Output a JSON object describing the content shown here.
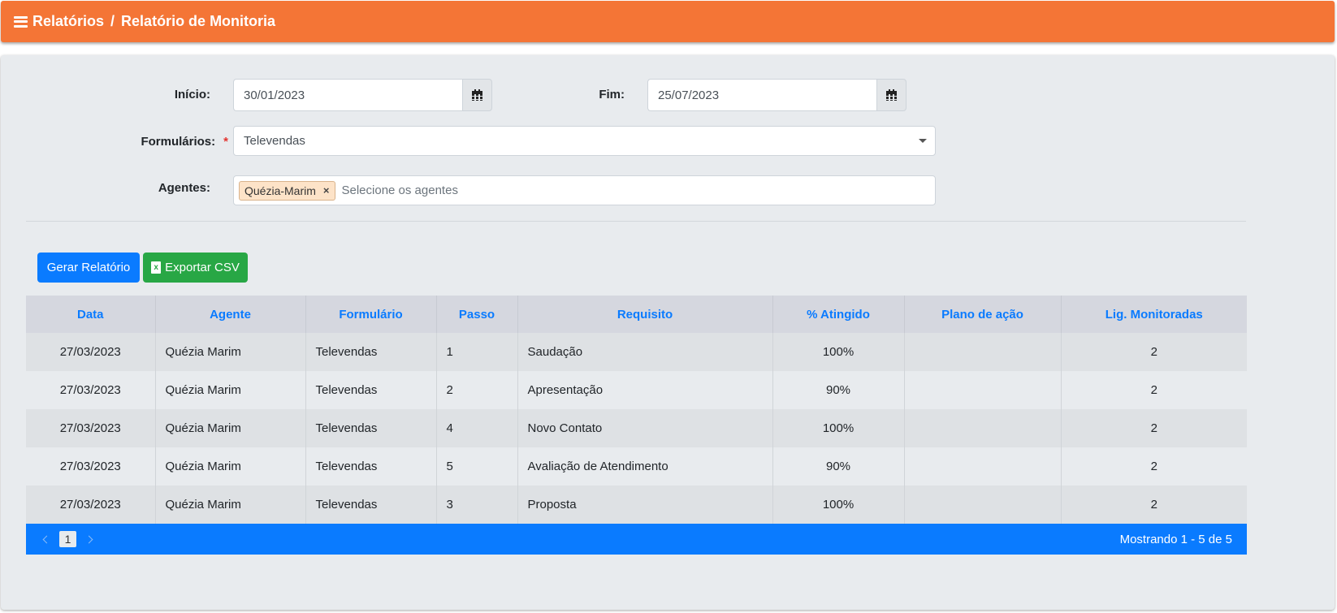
{
  "header": {
    "breadcrumb_root": "Relatórios",
    "separator": "/",
    "breadcrumb_current": "Relatório de Monitoria",
    "accent_color": "#f47536"
  },
  "filters": {
    "start_label": "Início:",
    "start_value": "30/01/2023",
    "end_label": "Fim:",
    "end_value": "25/07/2023",
    "forms_label": "Formulários:",
    "forms_required_mark": "*",
    "forms_value": "Televendas",
    "agents_label": "Agentes:",
    "agents_selected": [
      "Quézia-Marim"
    ],
    "agents_remove_symbol": "×",
    "agents_placeholder": "Selecione os agentes"
  },
  "actions": {
    "generate_label": "Gerar Relatório",
    "export_label": "Exportar CSV",
    "export_icon_letter": "x"
  },
  "table": {
    "columns": [
      "Data",
      "Agente",
      "Formulário",
      "Passo",
      "Requisito",
      "% Atingido",
      "Plano de ação",
      "Lig. Monitoradas"
    ],
    "rows": [
      [
        "27/03/2023",
        "Quézia Marim",
        "Televendas",
        "1",
        "Saudação",
        "100%",
        "",
        "2"
      ],
      [
        "27/03/2023",
        "Quézia Marim",
        "Televendas",
        "2",
        "Apresentação",
        "90%",
        "",
        "2"
      ],
      [
        "27/03/2023",
        "Quézia Marim",
        "Televendas",
        "4",
        "Novo Contato",
        "100%",
        "",
        "2"
      ],
      [
        "27/03/2023",
        "Quézia Marim",
        "Televendas",
        "5",
        "Avaliação de Atendimento",
        "90%",
        "",
        "2"
      ],
      [
        "27/03/2023",
        "Quézia Marim",
        "Televendas",
        "3",
        "Proposta",
        "100%",
        "",
        "2"
      ]
    ]
  },
  "pagination": {
    "current_page": "1",
    "info": "Mostrando 1 - 5 de 5"
  }
}
